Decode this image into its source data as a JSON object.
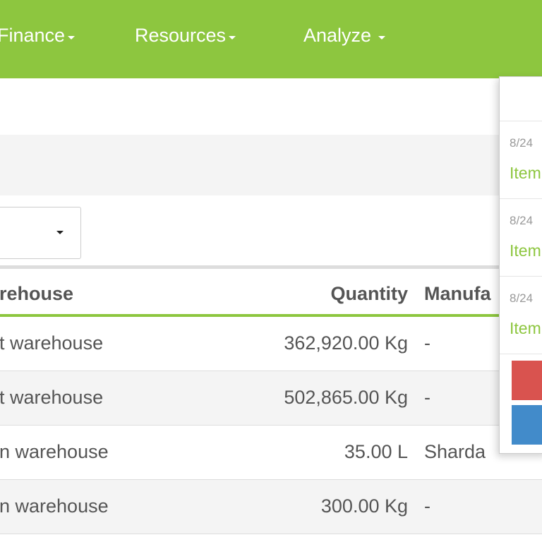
{
  "navbar": {
    "items": [
      {
        "label": "Finance"
      },
      {
        "label": "Resources"
      },
      {
        "label": "Analyze"
      }
    ],
    "color": "#8dc63f"
  },
  "table": {
    "headers": {
      "warehouse": "rehouse",
      "quantity": "Quantity",
      "manufacturer": "Manufa"
    },
    "rows": [
      {
        "warehouse": "t warehouse",
        "quantity": "362,920.00 Kg",
        "manufacturer": "-"
      },
      {
        "warehouse": "t warehouse",
        "quantity": "502,865.00 Kg",
        "manufacturer": "-"
      },
      {
        "warehouse": "n warehouse",
        "quantity": "35.00 L",
        "manufacturer": "Sharda"
      },
      {
        "warehouse": "n warehouse",
        "quantity": "300.00 Kg",
        "manufacturer": "-"
      }
    ]
  },
  "notifications": {
    "items": [
      {
        "date": "8/24",
        "link": "Item"
      },
      {
        "date": "8/24",
        "link": "Item"
      },
      {
        "date": "8/24",
        "link": "Item"
      }
    ],
    "buttons": [
      {
        "color": "#d9534f"
      },
      {
        "color": "#428bca"
      }
    ]
  }
}
